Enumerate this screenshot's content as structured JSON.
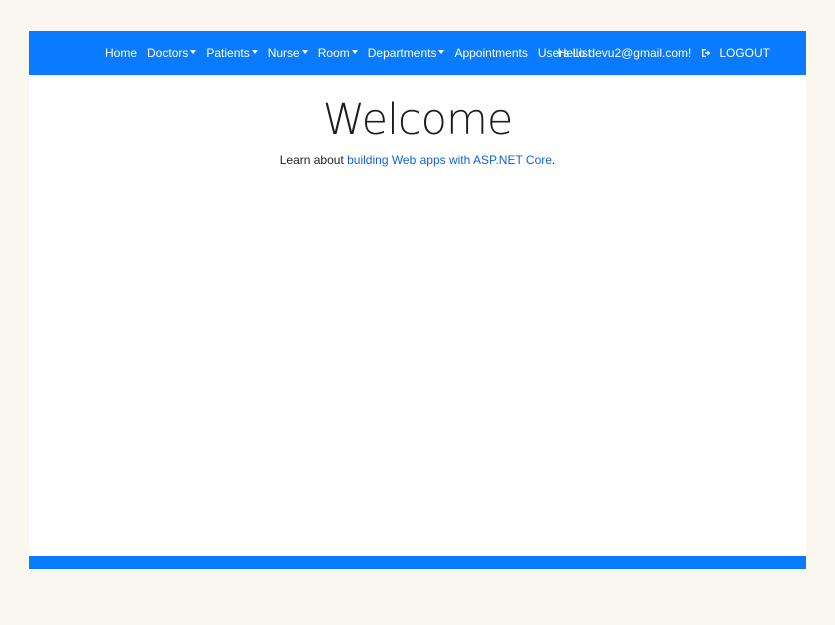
{
  "nav": {
    "items": [
      {
        "label": "Home",
        "dropdown": false
      },
      {
        "label": "Doctors",
        "dropdown": true
      },
      {
        "label": "Patients",
        "dropdown": true
      },
      {
        "label": "Nurse",
        "dropdown": true
      },
      {
        "label": "Room",
        "dropdown": true
      },
      {
        "label": "Departments",
        "dropdown": true
      },
      {
        "label": "Appointments",
        "dropdown": false
      },
      {
        "label": "Users List",
        "dropdown": false
      }
    ],
    "greeting": "Hello devu2@gmail.com!",
    "logout_label": "LOGOUT",
    "logout_icon": "sign-out-icon"
  },
  "main": {
    "title": "Welcome",
    "lead_prefix": "Learn about ",
    "lead_link": "building Web apps with ASP.NET Core",
    "lead_suffix": "."
  },
  "colors": {
    "accent": "#0a7bff",
    "link": "#0e66d6",
    "page_background": "#faf7ee"
  }
}
